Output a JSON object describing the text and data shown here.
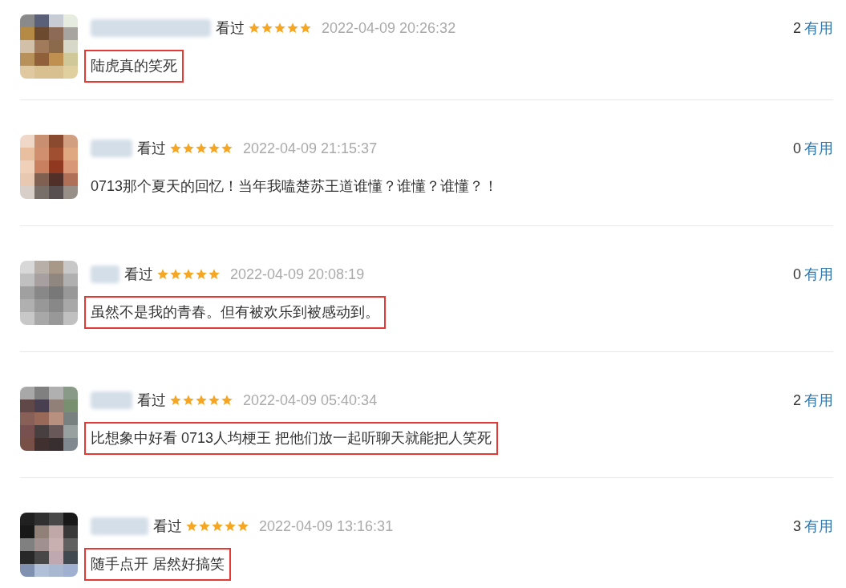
{
  "comments": [
    {
      "status": "看过",
      "stars": 5,
      "time": "2022-04-09 20:26:32",
      "votes": "2",
      "vote_label": "有用",
      "text": "陆虎真的笑死",
      "highlighted": true
    },
    {
      "status": "看过",
      "stars": 5,
      "time": "2022-04-09 21:15:37",
      "votes": "0",
      "vote_label": "有用",
      "text": "0713那个夏天的回忆！当年我嗑楚苏王道谁懂？谁懂？谁懂？！",
      "highlighted": false
    },
    {
      "status": "看过",
      "stars": 5,
      "time": "2022-04-09 20:08:19",
      "votes": "0",
      "vote_label": "有用",
      "text": "虽然不是我的青春。但有被欢乐到被感动到。",
      "highlighted": true
    },
    {
      "status": "看过",
      "stars": 5,
      "time": "2022-04-09 05:40:34",
      "votes": "2",
      "vote_label": "有用",
      "text": "比想象中好看 0713人均梗王 把他们放一起听聊天就能把人笑死",
      "highlighted": true
    },
    {
      "status": "看过",
      "stars": 5,
      "time": "2022-04-09 13:16:31",
      "votes": "3",
      "vote_label": "有用",
      "text": "随手点开 居然好搞笑",
      "highlighted": true
    }
  ]
}
